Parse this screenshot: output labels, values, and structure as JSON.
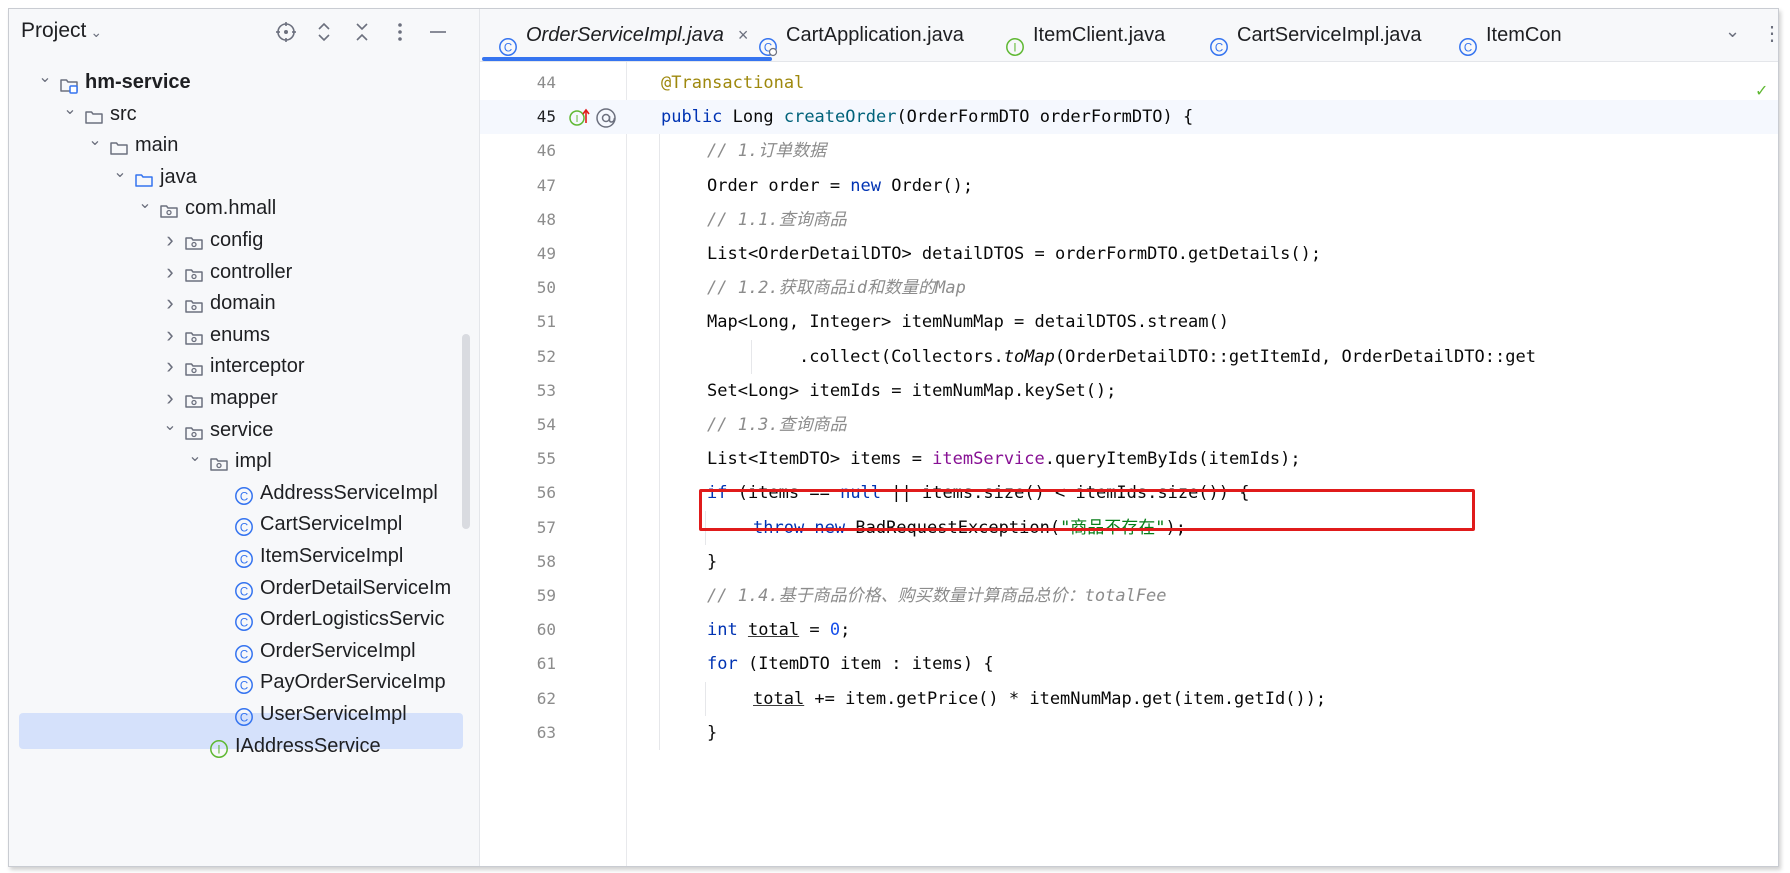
{
  "project_panel": {
    "title": "Project",
    "tools": [
      "crosshair-icon",
      "expand-icon",
      "collapse-icon",
      "more-vert-icon",
      "minimize-icon"
    ],
    "tree": [
      {
        "label": "hm-service",
        "depth": 0,
        "type": "module",
        "expanded": true,
        "bold": true
      },
      {
        "label": "src",
        "depth": 1,
        "type": "folder",
        "expanded": true
      },
      {
        "label": "main",
        "depth": 2,
        "type": "folder",
        "expanded": true
      },
      {
        "label": "java",
        "depth": 3,
        "type": "source-folder",
        "expanded": true
      },
      {
        "label": "com.hmall",
        "depth": 4,
        "type": "package",
        "expanded": true
      },
      {
        "label": "config",
        "depth": 5,
        "type": "package",
        "expanded": false
      },
      {
        "label": "controller",
        "depth": 5,
        "type": "package",
        "expanded": false
      },
      {
        "label": "domain",
        "depth": 5,
        "type": "package",
        "expanded": false
      },
      {
        "label": "enums",
        "depth": 5,
        "type": "package",
        "expanded": false
      },
      {
        "label": "interceptor",
        "depth": 5,
        "type": "package",
        "expanded": false
      },
      {
        "label": "mapper",
        "depth": 5,
        "type": "package",
        "expanded": false
      },
      {
        "label": "service",
        "depth": 5,
        "type": "package",
        "expanded": true
      },
      {
        "label": "impl",
        "depth": 6,
        "type": "package",
        "expanded": true
      },
      {
        "label": "AddressServiceImpl",
        "depth": 7,
        "type": "class"
      },
      {
        "label": "CartServiceImpl",
        "depth": 7,
        "type": "class"
      },
      {
        "label": "ItemServiceImpl",
        "depth": 7,
        "type": "class"
      },
      {
        "label": "OrderDetailServiceIm",
        "depth": 7,
        "type": "class"
      },
      {
        "label": "OrderLogisticsServic",
        "depth": 7,
        "type": "class"
      },
      {
        "label": "OrderServiceImpl",
        "depth": 7,
        "type": "class",
        "selected": true
      },
      {
        "label": "PayOrderServiceImp",
        "depth": 7,
        "type": "class"
      },
      {
        "label": "UserServiceImpl",
        "depth": 7,
        "type": "class"
      },
      {
        "label": "IAddressService",
        "depth": 6,
        "type": "interface"
      }
    ]
  },
  "tabs": [
    {
      "label": "OrderServiceImpl.java",
      "icon": "class-icon",
      "active": true,
      "close": "×"
    },
    {
      "label": "CartApplication.java",
      "icon": "spring-class-icon"
    },
    {
      "label": "ItemClient.java",
      "icon": "interface-icon"
    },
    {
      "label": "CartServiceImpl.java",
      "icon": "class-icon"
    },
    {
      "label": "ItemCon",
      "icon": "class-icon"
    }
  ],
  "editor": {
    "current_line": 45,
    "highlighted_line": 55,
    "lines": [
      {
        "no": "44",
        "indent": 1,
        "tokens": [
          [
            "anno",
            "@Transactional"
          ]
        ]
      },
      {
        "no": "45",
        "indent": 1,
        "tokens": [
          [
            "kw",
            "public "
          ],
          [
            "plain",
            "Long "
          ],
          [
            "method",
            "createOrder"
          ],
          [
            "plain",
            "(OrderFormDTO orderFormDTO) {"
          ]
        ]
      },
      {
        "no": "46",
        "indent": 2,
        "tokens": [
          [
            "cmt",
            "// 1.订单数据"
          ]
        ]
      },
      {
        "no": "47",
        "indent": 2,
        "tokens": [
          [
            "plain",
            "Order order = "
          ],
          [
            "kw",
            "new "
          ],
          [
            "plain",
            "Order();"
          ]
        ]
      },
      {
        "no": "48",
        "indent": 2,
        "tokens": [
          [
            "cmt",
            "// 1.1.查询商品"
          ]
        ]
      },
      {
        "no": "49",
        "indent": 2,
        "tokens": [
          [
            "plain",
            "List<OrderDetailDTO> detailDTOS = orderFormDTO.getDetails();"
          ]
        ]
      },
      {
        "no": "50",
        "indent": 2,
        "tokens": [
          [
            "cmt",
            "// 1.2.获取商品id和数量的Map"
          ]
        ]
      },
      {
        "no": "51",
        "indent": 2,
        "tokens": [
          [
            "plain",
            "Map<Long, Integer> itemNumMap = detailDTOS.stream()"
          ]
        ]
      },
      {
        "no": "52",
        "indent": 4,
        "tokens": [
          [
            "plain",
            ".collect(Collectors."
          ],
          [
            "static",
            "toMap"
          ],
          [
            "plain",
            "(OrderDetailDTO::getItemId, OrderDetailDTO::get"
          ]
        ]
      },
      {
        "no": "53",
        "indent": 2,
        "tokens": [
          [
            "plain",
            "Set<Long> itemIds = itemNumMap.keySet();"
          ]
        ]
      },
      {
        "no": "54",
        "indent": 2,
        "tokens": [
          [
            "cmt",
            "// 1.3.查询商品"
          ]
        ]
      },
      {
        "no": "55",
        "indent": 2,
        "tokens": [
          [
            "plain",
            "List<ItemDTO> items = "
          ],
          [
            "field",
            "itemService"
          ],
          [
            "plain",
            ".queryItemByIds(itemIds);"
          ]
        ]
      },
      {
        "no": "56",
        "indent": 2,
        "tokens": [
          [
            "kw",
            "if "
          ],
          [
            "plain",
            "(items == "
          ],
          [
            "kw",
            "null "
          ],
          [
            "plain",
            "|| items.size() < itemIds.size()) {"
          ]
        ]
      },
      {
        "no": "57",
        "indent": 3,
        "tokens": [
          [
            "kw",
            "throw new "
          ],
          [
            "plain",
            "BadRequestException("
          ],
          [
            "str",
            "\"商品不存在\""
          ],
          [
            "plain",
            ");"
          ]
        ]
      },
      {
        "no": "58",
        "indent": 2,
        "tokens": [
          [
            "plain",
            "}"
          ]
        ]
      },
      {
        "no": "59",
        "indent": 2,
        "tokens": [
          [
            "cmt",
            "// 1.4.基于商品价格、购买数量计算商品总价：totalFee"
          ]
        ]
      },
      {
        "no": "60",
        "indent": 2,
        "tokens": [
          [
            "kw",
            "int "
          ],
          [
            "under",
            "total"
          ],
          [
            "plain",
            " = "
          ],
          [
            "num",
            "0"
          ],
          [
            "plain",
            ";"
          ]
        ]
      },
      {
        "no": "61",
        "indent": 2,
        "tokens": [
          [
            "kw",
            "for "
          ],
          [
            "plain",
            "(ItemDTO item : items) {"
          ]
        ]
      },
      {
        "no": "62",
        "indent": 3,
        "tokens": [
          [
            "under",
            "total"
          ],
          [
            "plain",
            " += item.getPrice() * itemNumMap.get(item.getId());"
          ]
        ]
      },
      {
        "no": "63",
        "indent": 2,
        "tokens": [
          [
            "plain",
            "}"
          ]
        ]
      }
    ]
  },
  "colors": {
    "keyword": "#0033b3",
    "annotation": "#9e880d",
    "comment": "#8c8c8c",
    "string": "#067d17",
    "number": "#1750eb",
    "field": "#871094",
    "highlight_box": "#e01b1b",
    "selection": "#d5e1fb",
    "accent": "#3574f0"
  }
}
